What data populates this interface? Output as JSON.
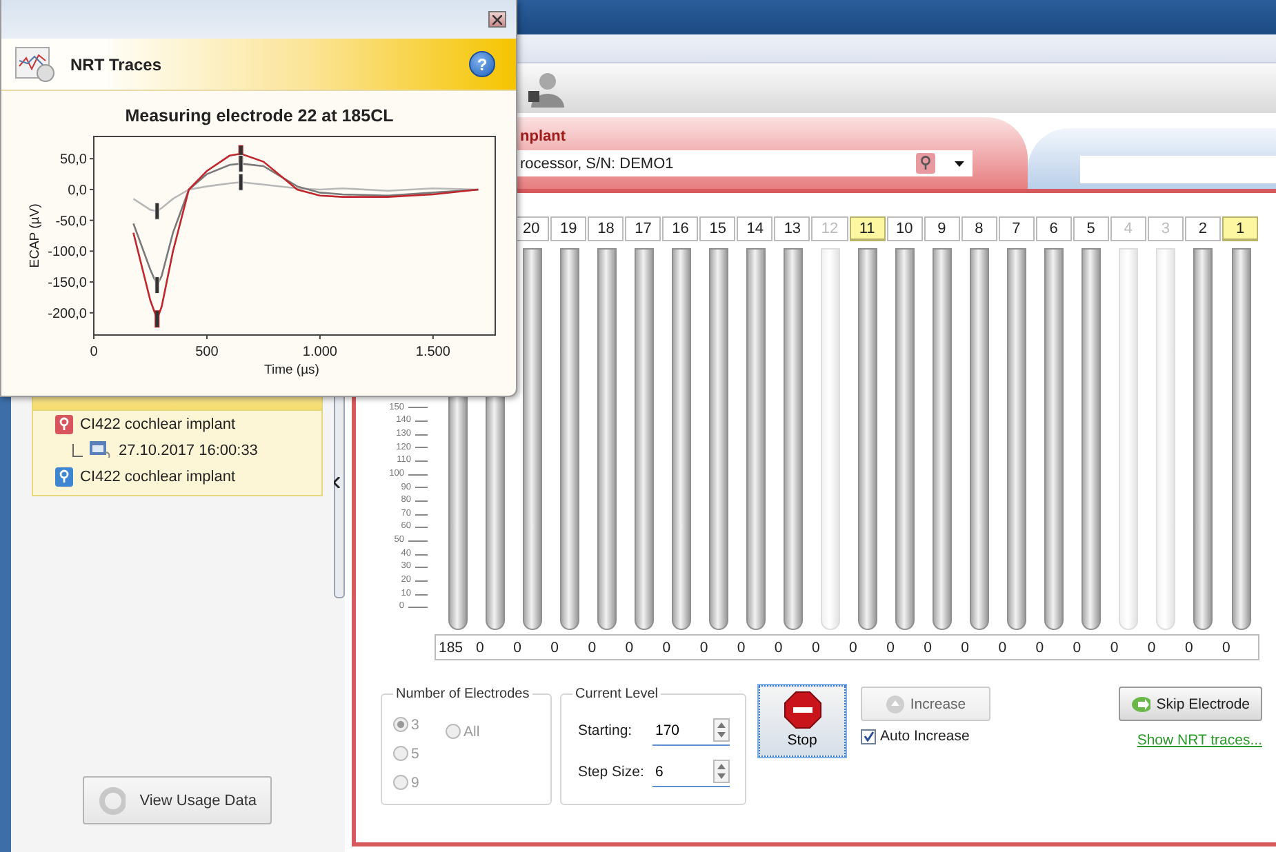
{
  "toolbar": {
    "kind": "person"
  },
  "left_panel": {
    "tree": [
      {
        "label": "CI422 cochlear implant",
        "color": "#d9555e",
        "children": [
          {
            "label": "27.10.2017 16:00:33"
          }
        ]
      },
      {
        "label": "CI422 cochlear implant",
        "color": "#3f86d2"
      }
    ],
    "button": "View Usage Data"
  },
  "tabs": [
    {
      "title": "nplant",
      "device": "rocessor, S/N: DEMO1",
      "selected": true
    },
    {
      "selected": false
    }
  ],
  "scale_labels": [
    "150",
    "140",
    "130",
    "120",
    "110",
    "100",
    "90",
    "80",
    "70",
    "60",
    "50",
    "40",
    "30",
    "20",
    "10",
    "0"
  ],
  "electrodes": [
    {
      "disabled": false,
      "value": "185"
    },
    {
      "disabled": false,
      "value": "0"
    },
    {
      "label": "20",
      "selected": false,
      "disabled": false,
      "value": "0"
    },
    {
      "label": "19",
      "selected": false,
      "disabled": false,
      "value": "0"
    },
    {
      "label": "18",
      "selected": false,
      "disabled": false,
      "value": "0"
    },
    {
      "label": "17",
      "selected": false,
      "disabled": false,
      "value": "0"
    },
    {
      "label": "16",
      "selected": false,
      "disabled": false,
      "value": "0"
    },
    {
      "label": "15",
      "selected": false,
      "disabled": false,
      "value": "0"
    },
    {
      "label": "14",
      "selected": false,
      "disabled": false,
      "value": "0"
    },
    {
      "label": "13",
      "selected": false,
      "disabled": false,
      "value": "0"
    },
    {
      "label": "12",
      "selected": false,
      "disabled": true,
      "value": "0"
    },
    {
      "label": "11",
      "selected": true,
      "disabled": false,
      "value": "0"
    },
    {
      "label": "10",
      "selected": false,
      "disabled": false,
      "value": "0"
    },
    {
      "label": "9",
      "selected": false,
      "disabled": false,
      "value": "0"
    },
    {
      "label": "8",
      "selected": false,
      "disabled": false,
      "value": "0"
    },
    {
      "label": "7",
      "selected": false,
      "disabled": false,
      "value": "0"
    },
    {
      "label": "6",
      "selected": false,
      "disabled": false,
      "value": "0"
    },
    {
      "label": "5",
      "selected": false,
      "disabled": false,
      "value": "0"
    },
    {
      "label": "4",
      "selected": false,
      "disabled": true,
      "value": "0"
    },
    {
      "label": "3",
      "selected": false,
      "disabled": true,
      "value": "0"
    },
    {
      "label": "2",
      "selected": false,
      "disabled": false,
      "value": "0"
    },
    {
      "label": "1",
      "selected": true,
      "disabled": false,
      "value": "0"
    }
  ],
  "electrode_count": {
    "title": "Number of Electrodes",
    "disabled": true,
    "options": [
      {
        "label": "3",
        "selected": true
      },
      {
        "label": "5",
        "selected": false
      },
      {
        "label": "9",
        "selected": false
      },
      {
        "label": "All",
        "selected": false
      }
    ]
  },
  "current_level": {
    "title": "Current Level",
    "fields": [
      {
        "label": "Starting:",
        "value": "170"
      },
      {
        "label": "Step Size:",
        "value": "6"
      }
    ]
  },
  "stop_button": "Stop",
  "increase_button": {
    "label": "Increase",
    "disabled": true
  },
  "auto_increase": {
    "label": "Auto Increase",
    "checked": true
  },
  "skip_button": "Skip Electrode",
  "traces_link": "Show NRT traces...",
  "popup": {
    "title": "NRT Traces",
    "help": "?",
    "chart_data": {
      "type": "line",
      "title": "Measuring electrode 22 at 185CL",
      "xlabel": "Time (µs)",
      "ylabel": "ECAP (µV)",
      "x": [
        175,
        250,
        280,
        300,
        350,
        420,
        500,
        600,
        650,
        750,
        900,
        1000,
        1100,
        1300,
        1500,
        1700
      ],
      "series": [
        {
          "color": "#c0262d",
          "values": [
            -70,
            -180,
            -210,
            -190,
            -100,
            0,
            30,
            55,
            58,
            45,
            0,
            -10,
            -12,
            -12,
            -8,
            0
          ]
        },
        {
          "color": "#7a7a7a",
          "values": [
            -55,
            -130,
            -155,
            -140,
            -70,
            0,
            25,
            40,
            42,
            38,
            5,
            -5,
            -8,
            -10,
            -5,
            0
          ]
        },
        {
          "color": "#b8b8b8",
          "values": [
            -15,
            -33,
            -35,
            -30,
            -15,
            0,
            5,
            10,
            12,
            8,
            2,
            0,
            2,
            -2,
            2,
            0
          ]
        }
      ],
      "xlim": [
        0,
        1775
      ],
      "ylim": [
        -236,
        86
      ],
      "xticks": [
        0,
        500,
        {
          "value": 1000,
          "label": "1.000"
        },
        {
          "value": 1500,
          "label": "1.500"
        }
      ],
      "yticks": [
        {
          "value": 50,
          "label": "50,0"
        },
        {
          "value": 0,
          "label": "0,0"
        },
        {
          "value": -50,
          "label": "-50,0"
        },
        {
          "value": -100,
          "label": "-100,0"
        },
        {
          "value": -150,
          "label": "-150,0"
        },
        {
          "value": -200,
          "label": "-200,0"
        }
      ]
    }
  }
}
